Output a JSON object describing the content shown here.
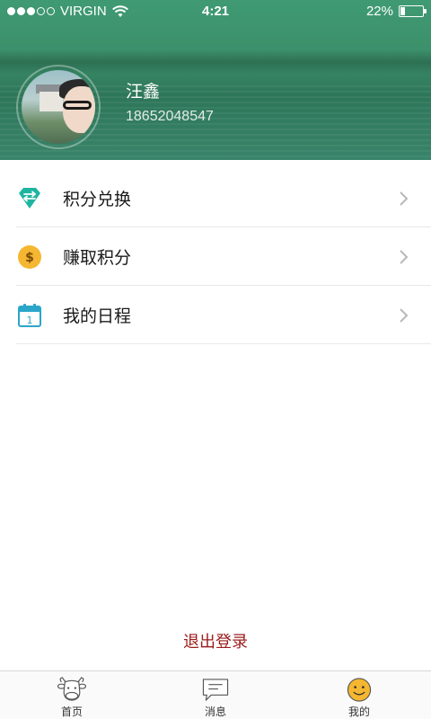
{
  "status_bar": {
    "carrier": "VIRGIN",
    "time": "4:21",
    "battery_percent": "22%",
    "battery_level": 0.22
  },
  "profile": {
    "name": "汪鑫",
    "phone": "18652048547"
  },
  "menu": {
    "items": [
      {
        "label": "积分兑换",
        "icon": "diamond-exchange-icon",
        "color": "#1fb5a0"
      },
      {
        "label": "赚取积分",
        "icon": "dollar-coin-icon",
        "color": "#f5b731"
      },
      {
        "label": "我的日程",
        "icon": "calendar-icon",
        "color": "#2ba6c9"
      }
    ]
  },
  "logout_label": "退出登录",
  "tabbar": {
    "tabs": [
      {
        "label": "首页",
        "icon": "cow-head-icon",
        "active": false
      },
      {
        "label": "消息",
        "icon": "message-icon",
        "active": false
      },
      {
        "label": "我的",
        "icon": "smiley-icon",
        "active": true
      }
    ]
  },
  "colors": {
    "header": "#3c8f6a",
    "logout": "#9b1b1b",
    "accent_active": "#f5b731"
  }
}
